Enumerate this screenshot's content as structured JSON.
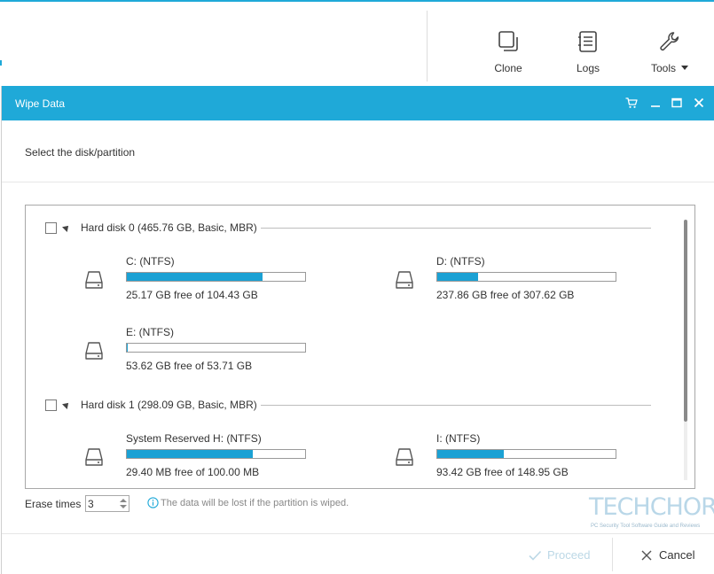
{
  "toolbar": {
    "items": [
      {
        "label": "Clone",
        "icon": "clone-icon"
      },
      {
        "label": "Logs",
        "icon": "logs-icon"
      },
      {
        "label": "Tools",
        "icon": "wrench-icon"
      }
    ]
  },
  "dialog": {
    "title": "Wipe Data",
    "prompt": "Select the disk/partition",
    "disks": [
      {
        "title": "Hard disk 0 (465.76 GB, Basic, MBR)",
        "checked": false,
        "partitions": [
          {
            "name": "C: (NTFS)",
            "free": "25.17 GB free of 104.43 GB",
            "used_fraction": 0.759
          },
          {
            "name": "D: (NTFS)",
            "free": "237.86 GB free of 307.62 GB",
            "used_fraction": 0.227
          },
          {
            "name": "E: (NTFS)",
            "free": "53.62 GB free of 53.71 GB",
            "used_fraction": 0.002
          }
        ]
      },
      {
        "title": "Hard disk 1 (298.09 GB, Basic, MBR)",
        "checked": false,
        "partitions": [
          {
            "name": "System Reserved H: (NTFS)",
            "free": "29.40 MB free of 100.00 MB",
            "used_fraction": 0.706
          },
          {
            "name": "I: (NTFS)",
            "free": "93.42 GB free of 148.95 GB",
            "used_fraction": 0.373
          }
        ]
      }
    ],
    "erase_times_label": "Erase times",
    "erase_times_value": "3",
    "warning": "The data will be lost if the partition is wiped.",
    "proceed_label": "Proceed",
    "cancel_label": "Cancel"
  },
  "watermark": {
    "main": "TECHCHORE",
    "sub": "PC Security Tool Software Guide and Reviews"
  },
  "colors": {
    "accent": "#1fa9d8",
    "bar_fill": "#1ba1d4"
  }
}
